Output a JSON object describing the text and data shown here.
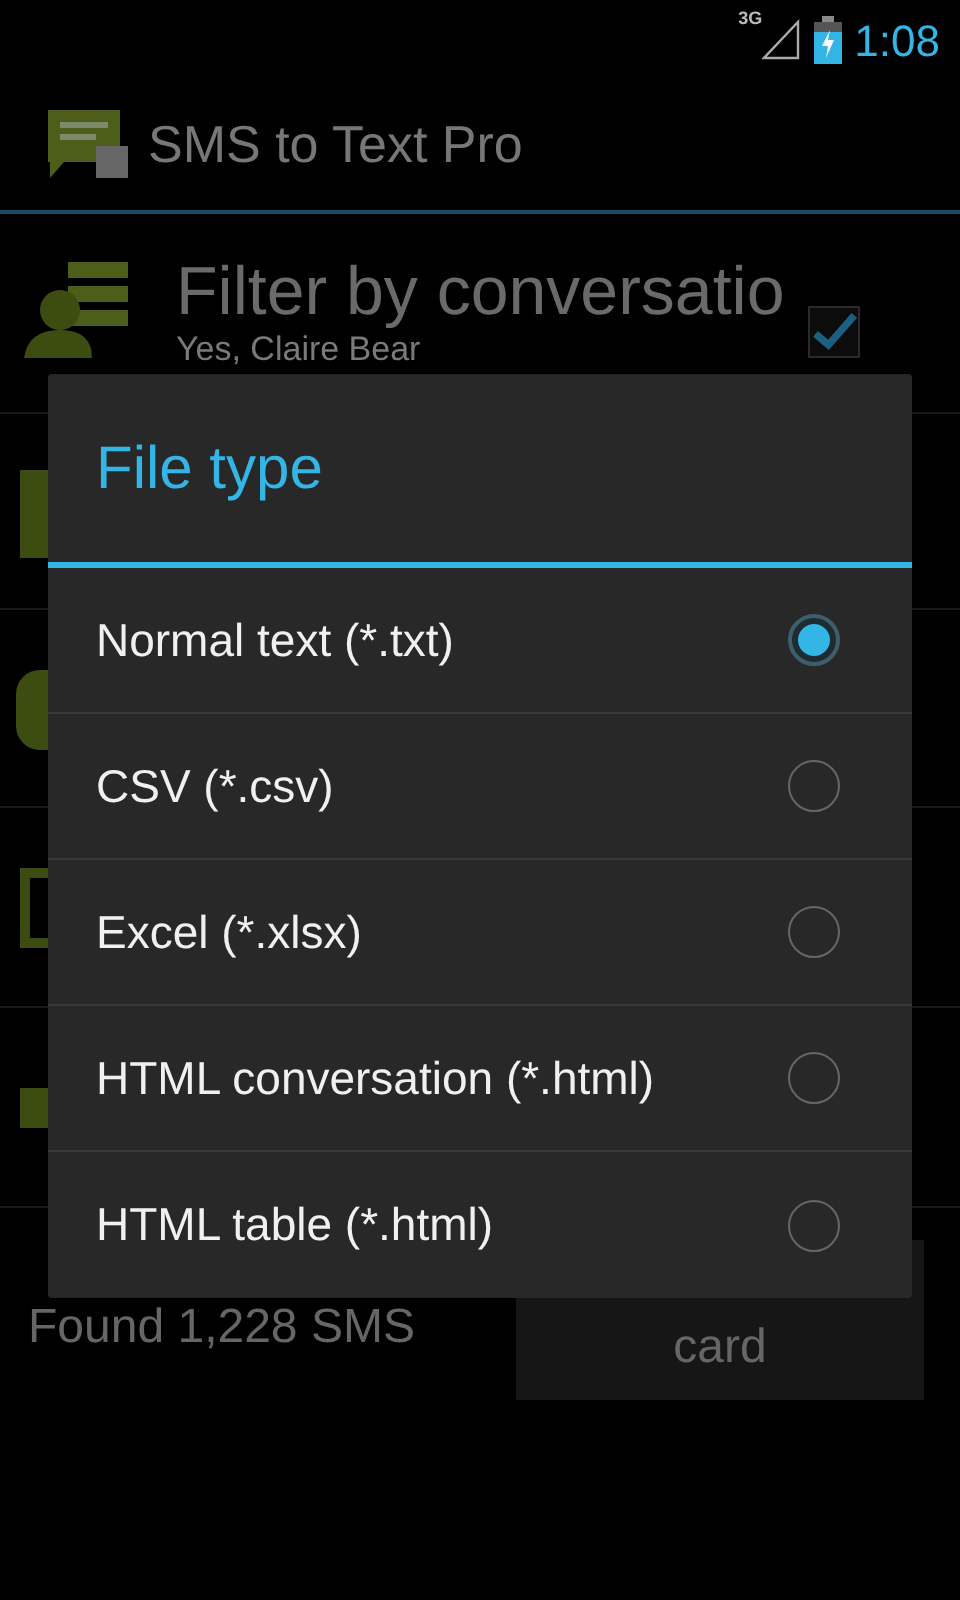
{
  "status_bar": {
    "network": "3G",
    "time": "1:08"
  },
  "app_bar": {
    "title": "SMS to Text Pro"
  },
  "settings": [
    {
      "title": "Filter by conversatio",
      "summary": "Yes, Claire Bear",
      "checked": true
    }
  ],
  "footer": {
    "count": "Found 1,228 SMS",
    "export_button": "card"
  },
  "dialog": {
    "title": "File type",
    "options": [
      {
        "label": "Normal text (*.txt)",
        "selected": true
      },
      {
        "label": "CSV (*.csv)",
        "selected": false
      },
      {
        "label": "Excel (*.xlsx)",
        "selected": false
      },
      {
        "label": "HTML conversation (*.html)",
        "selected": false
      },
      {
        "label": "HTML table (*.html)",
        "selected": false
      }
    ]
  }
}
